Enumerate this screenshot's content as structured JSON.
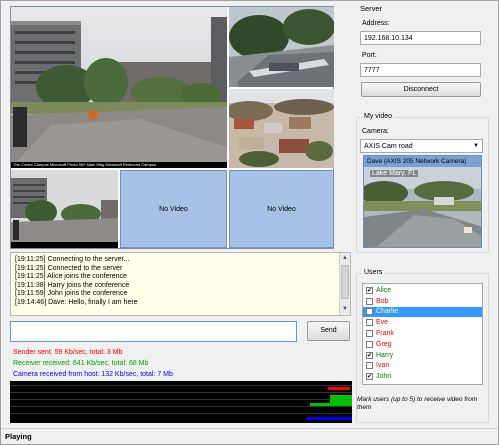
{
  "videos": {
    "caption_main": "The Cortex Campus Microsoft Photo 500 Main Bldg Microsoft Redmond Campus",
    "no_video": "No Video"
  },
  "log": {
    "lines": [
      "[19:11:25] Connecting to the server...",
      "[19:11:25] Connected to the server",
      "[19:11:25] Alice joins the conference",
      "[19:11:38] Harry joins the conference",
      "[19:11:59] John joins the conference",
      "[19:14:46] Dave: Hello, finally I am here"
    ]
  },
  "message": {
    "value": "",
    "send_label": "Send"
  },
  "stats": {
    "sender": "Sender sent: 59 Kb/sec, total: 3 Mb",
    "receiver": "Receiver received: 641 Kb/sec, total: 68 Mb",
    "camera": "Camera received from host: 132 Kb/sec, total: 7 Mb",
    "sender_color": "#ff0000",
    "receiver_color": "#00a000",
    "camera_color": "#0000ff"
  },
  "server": {
    "title": "Server",
    "address_label": "Address:",
    "address_value": "192.168.10.134",
    "port_label": "Port:",
    "port_value": "7777",
    "disconnect_label": "Disconnect"
  },
  "my_video": {
    "title": "My video",
    "camera_label": "Camera:",
    "camera_value": "AXIS Cam road",
    "preview_title": "Dave (AXIS 205 Network Camera)",
    "preview_overlay": "Lake Mary, FL"
  },
  "users": {
    "title": "Users",
    "list": [
      {
        "name": "Alice",
        "checked": true,
        "color": "#008000",
        "selected": false
      },
      {
        "name": "Bob",
        "checked": false,
        "color": "#ff0000",
        "selected": false
      },
      {
        "name": "Charlie",
        "checked": false,
        "color": "#ff0000",
        "selected": true
      },
      {
        "name": "Eve",
        "checked": false,
        "color": "#ff0000",
        "selected": false
      },
      {
        "name": "Frank",
        "checked": false,
        "color": "#ff0000",
        "selected": false
      },
      {
        "name": "Greg",
        "checked": false,
        "color": "#ff0000",
        "selected": false
      },
      {
        "name": "Harry",
        "checked": true,
        "color": "#008000",
        "selected": false
      },
      {
        "name": "Ivan",
        "checked": false,
        "color": "#ff0000",
        "selected": false
      },
      {
        "name": "John",
        "checked": true,
        "color": "#008000",
        "selected": false
      }
    ],
    "hint": "Mark users (up to 5) to receive video from them"
  },
  "status": {
    "text": "Playing"
  },
  "colors": {
    "accent": "#3399ff",
    "novideo_bg": "#a7c2e6",
    "log_bg": "#ffffe8"
  }
}
